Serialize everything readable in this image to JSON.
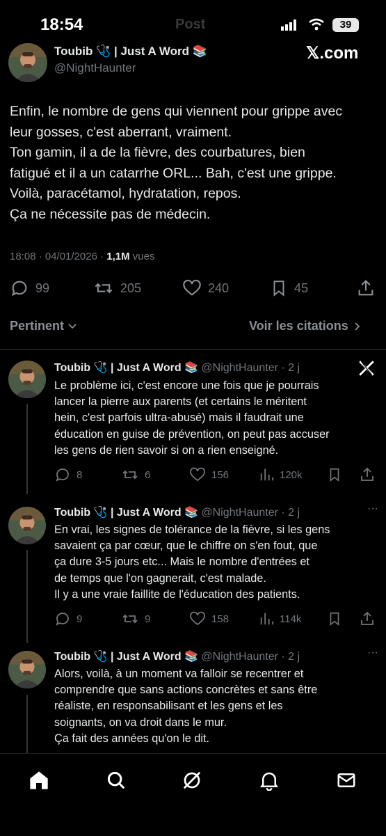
{
  "status_bar": {
    "time": "18:54",
    "faded_title": "Post",
    "battery": "39"
  },
  "watermark": "𝕏.com",
  "author": {
    "name": "Toubib 🩺 | Just A Word 📚",
    "handle": "@NightHaunter"
  },
  "main_post": {
    "lines": [
      "Enfin, le nombre de gens qui viennent pour grippe avec",
      "leur gosses, c'est aberrant, vraiment.",
      "Ton gamin, il a de la fièvre, des courbatures, bien",
      "fatigué et il a un catarrhe ORL... Bah, c'est une grippe.",
      "Voilà, paracétamol, hydratation, repos.",
      "Ça ne nécessite pas de médecin."
    ],
    "timestamp": "18:08 · 04/01/2026 · ",
    "views_count": "1,1M",
    "views_label": " vues",
    "replies": "99",
    "reposts": "205",
    "likes": "240",
    "bookmarks": "45"
  },
  "sort": {
    "relevance_label": "Pertinent",
    "quotes_label": "Voir les citations"
  },
  "replies": [
    {
      "name": "Toubib 🩺 | Just A Word 📚",
      "handle": "@NightHaunter · 2 j",
      "lines": [
        "Le problème ici, c'est encore une fois que je pourrais",
        "lancer la pierre aux parents (et certains le méritent",
        "hein, c'est parfois ultra-abusé) mais il faudrait une",
        "éducation en guise de prévention, on peut pas accuser",
        "les gens de rien savoir si on a rien enseigné."
      ],
      "replies": "8",
      "reposts": "6",
      "likes": "156",
      "views": "120k"
    },
    {
      "name": "Toubib 🩺 | Just A Word 📚",
      "handle": "@NightHaunter · 2 j",
      "lines": [
        "En vrai, les signes de tolérance de la fièvre, si les gens",
        "savaient ça par cœur, que le chiffre on s'en fout, que",
        "ça dure 3-5 jours etc... Mais le nombre d'entrées et",
        "de temps que l'on gagnerait, c'est malade.",
        "Il y a une vraie faillite de l'éducation des patients."
      ],
      "replies": "9",
      "reposts": "9",
      "likes": "158",
      "views": "114k"
    },
    {
      "name": "Toubib 🩺 | Just A Word 📚",
      "handle": "@NightHaunter · 2 j",
      "lines": [
        "Alors, voilà, à un moment va falloir se recentrer et",
        "comprendre que sans actions concrètes et sans être",
        "réaliste, en responsabilisant et les gens et les",
        "soignants, on va droit dans le mur.",
        "Ça fait des années qu'on le dit."
      ]
    }
  ],
  "colors": {
    "background": "#000000",
    "text": "#e7e9ea",
    "secondary": "#71767b",
    "divider": "#2f3336"
  }
}
